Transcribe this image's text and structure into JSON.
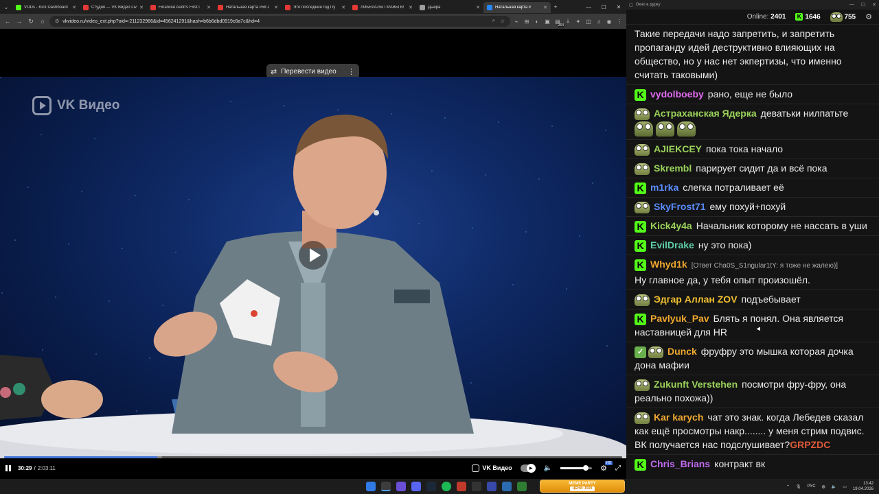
{
  "browser": {
    "tabs": [
      {
        "label": "VODs - Kick Dashboard",
        "color": "#53fc18",
        "active": false
      },
      {
        "label": "Студия — VK Видео Liv",
        "color": "#e53935",
        "active": false
      },
      {
        "label": "Financial Audit's First I",
        "color": "#e53935",
        "active": false
      },
      {
        "label": "Натальная карта #58 J",
        "color": "#e53935",
        "active": false
      },
      {
        "label": "Это последний год Пу",
        "color": "#e53935",
        "active": false
      },
      {
        "label": "ЛИБЕРАЛЫ ПРАВЫ В!",
        "color": "#e53935",
        "active": false
      },
      {
        "label": "Дьюра",
        "color": "#9e9e9e",
        "active": false
      },
      {
        "label": "Натальная карта #",
        "color": "#2787f5",
        "active": true
      }
    ],
    "new_tab": "+",
    "url": "vkvideo.ru/video_ext.php?oid=-211232966&id=456241291&hash=b6b6dbd0919c8a7c&hd=4",
    "ext_badge": "264"
  },
  "video": {
    "watermark": "VK Видео",
    "translate_label": "Перевести видео",
    "current_time": "30:29",
    "separator": "/",
    "total_time": "2:03:11",
    "progress": 0.248,
    "buffered": 0.255,
    "volume": 0.8,
    "brand": "VK Видео",
    "quality_badge": "HD"
  },
  "chat": {
    "window_title": "Окно в дурку",
    "online_label": "Online:",
    "online_count": "2401",
    "kick_count": "1646",
    "frog_count": "755",
    "messages": [
      {
        "user": "",
        "color": "#eaeaea",
        "badges": [],
        "text": "Такие передачи надо запретить, и запретить пропаганду идей деструктивно влияющих на общество, но у нас нет экпертизы, что именно считать таковыми)"
      },
      {
        "user": "vydolboeby",
        "color": "#e06cf0",
        "badges": [
          "kick"
        ],
        "text": "рано, еще не было"
      },
      {
        "user": "Астраханская Ядерка",
        "color": "#9bd35a",
        "badges": [
          "frog"
        ],
        "text": "деватьки нилпатьте"
      },
      {
        "user": "AJIEKCEY",
        "color": "#9bd35a",
        "badges": [
          "frog"
        ],
        "text": "пока тока начало"
      },
      {
        "user": "Skrembl",
        "color": "#9bd35a",
        "badges": [
          "frog"
        ],
        "text": "парирует сидит да и всё пока"
      },
      {
        "user": "m1rka",
        "color": "#5b8cff",
        "badges": [
          "kick"
        ],
        "text": "слегка потраливает её"
      },
      {
        "user": "SkyFrost71",
        "color": "#5b8cff",
        "badges": [
          "frog"
        ],
        "text": "ему похуй+похуй"
      },
      {
        "user": "Kick4y4a",
        "color": "#9bd35a",
        "badges": [
          "kick"
        ],
        "text": "Начальник которому не нассать в уши"
      },
      {
        "user": "EvilDrake",
        "color": "#5fd0a8",
        "badges": [
          "kick"
        ],
        "text": "ну это пока)"
      },
      {
        "user": "Whyd1k",
        "color": "#f0a830",
        "badges": [
          "kick"
        ],
        "reply": "[Ответ Cha0S_S1ngular1tY: я тоже не жалею)]",
        "text": "Ну главное да, у тебя опыт произошёл."
      },
      {
        "user": "Эдгар Аллан ZOV",
        "color": "#f0c030",
        "badges": [
          "frog"
        ],
        "text": "подъебывает"
      },
      {
        "user": "Pavlyuk_Pav",
        "color": "#f0a830",
        "badges": [
          "kick"
        ],
        "text": "Блять я понял. Она является наставницей для HR"
      },
      {
        "user": "Dunck",
        "color": "#f0a830",
        "badges": [
          "check",
          "frog"
        ],
        "text": "фруфру это мышка которая дочка дона мафии"
      },
      {
        "user": "Zukunft Verstehen",
        "color": "#9bd35a",
        "badges": [
          "frog"
        ],
        "text": "посмотри фру-фру, она реально похожа))"
      },
      {
        "user": "Kar karych",
        "color": "#f0a830",
        "badges": [
          "frog"
        ],
        "text": "чат это знак. когда Лебедев сказал как ещё просмотры накр........ у меня стрим подвис. ВК получается нас подслушивает?",
        "suffix": "GRPZDC"
      },
      {
        "user": "Chris_Brians",
        "color": "#c06cf0",
        "badges": [
          "kick"
        ],
        "text": "контракт вк"
      }
    ]
  },
  "taskbar": {
    "meme_title": "MEME PARTY",
    "meme_sub": "ЦЕНА: 1500",
    "lang": "РУС",
    "time": "13:42",
    "date": "19.04.2026"
  },
  "colors": {
    "kick_green": "#53fc18",
    "vk_blue": "#3f72d8",
    "chat_bg": "#141414"
  }
}
